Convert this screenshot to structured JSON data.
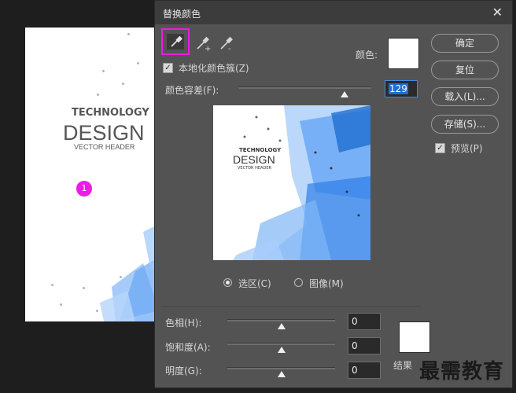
{
  "dialog": {
    "title": "替换颜色",
    "close_icon": "close-icon",
    "color_label": "颜色:",
    "localize_label": "本地化颜色簇(Z)",
    "localize_checked": true,
    "fuzziness_label": "颜色容差(F):",
    "fuzziness_value": "129",
    "fuzziness_level": 0.8
  },
  "tools": [
    "eyedropper-icon",
    "eyedropper-plus-icon",
    "eyedropper-minus-icon"
  ],
  "buttons": {
    "ok": "确定",
    "reset": "复位",
    "load": "载入(L)...",
    "save": "存储(S)..."
  },
  "preview_option": {
    "label": "预览(P)",
    "checked": true
  },
  "view_mode": {
    "selection": "选区(C)",
    "image": "图像(M)",
    "selected": "selection"
  },
  "adjust": {
    "hue_label": "色相(H):",
    "hue_value": "0",
    "saturation_label": "饱和度(A):",
    "saturation_value": "0",
    "lightness_label": "明度(G):",
    "lightness_value": "0",
    "result_label": "结果"
  },
  "document": {
    "line1": "TECHNOLOGY",
    "line2": "DESIGN",
    "line3": "VECTOR HEADER",
    "marker": "1"
  },
  "preview_text": {
    "line1": "TECHNOLOGY",
    "line2": "DESIGN",
    "line3": "VECTOR HEADER"
  },
  "watermark": "最需教育",
  "colors": {
    "accent_highlight": "#ee1ae6",
    "selection_blue": "#1f6fd1",
    "graphic_blue": "#3d8ef0"
  }
}
